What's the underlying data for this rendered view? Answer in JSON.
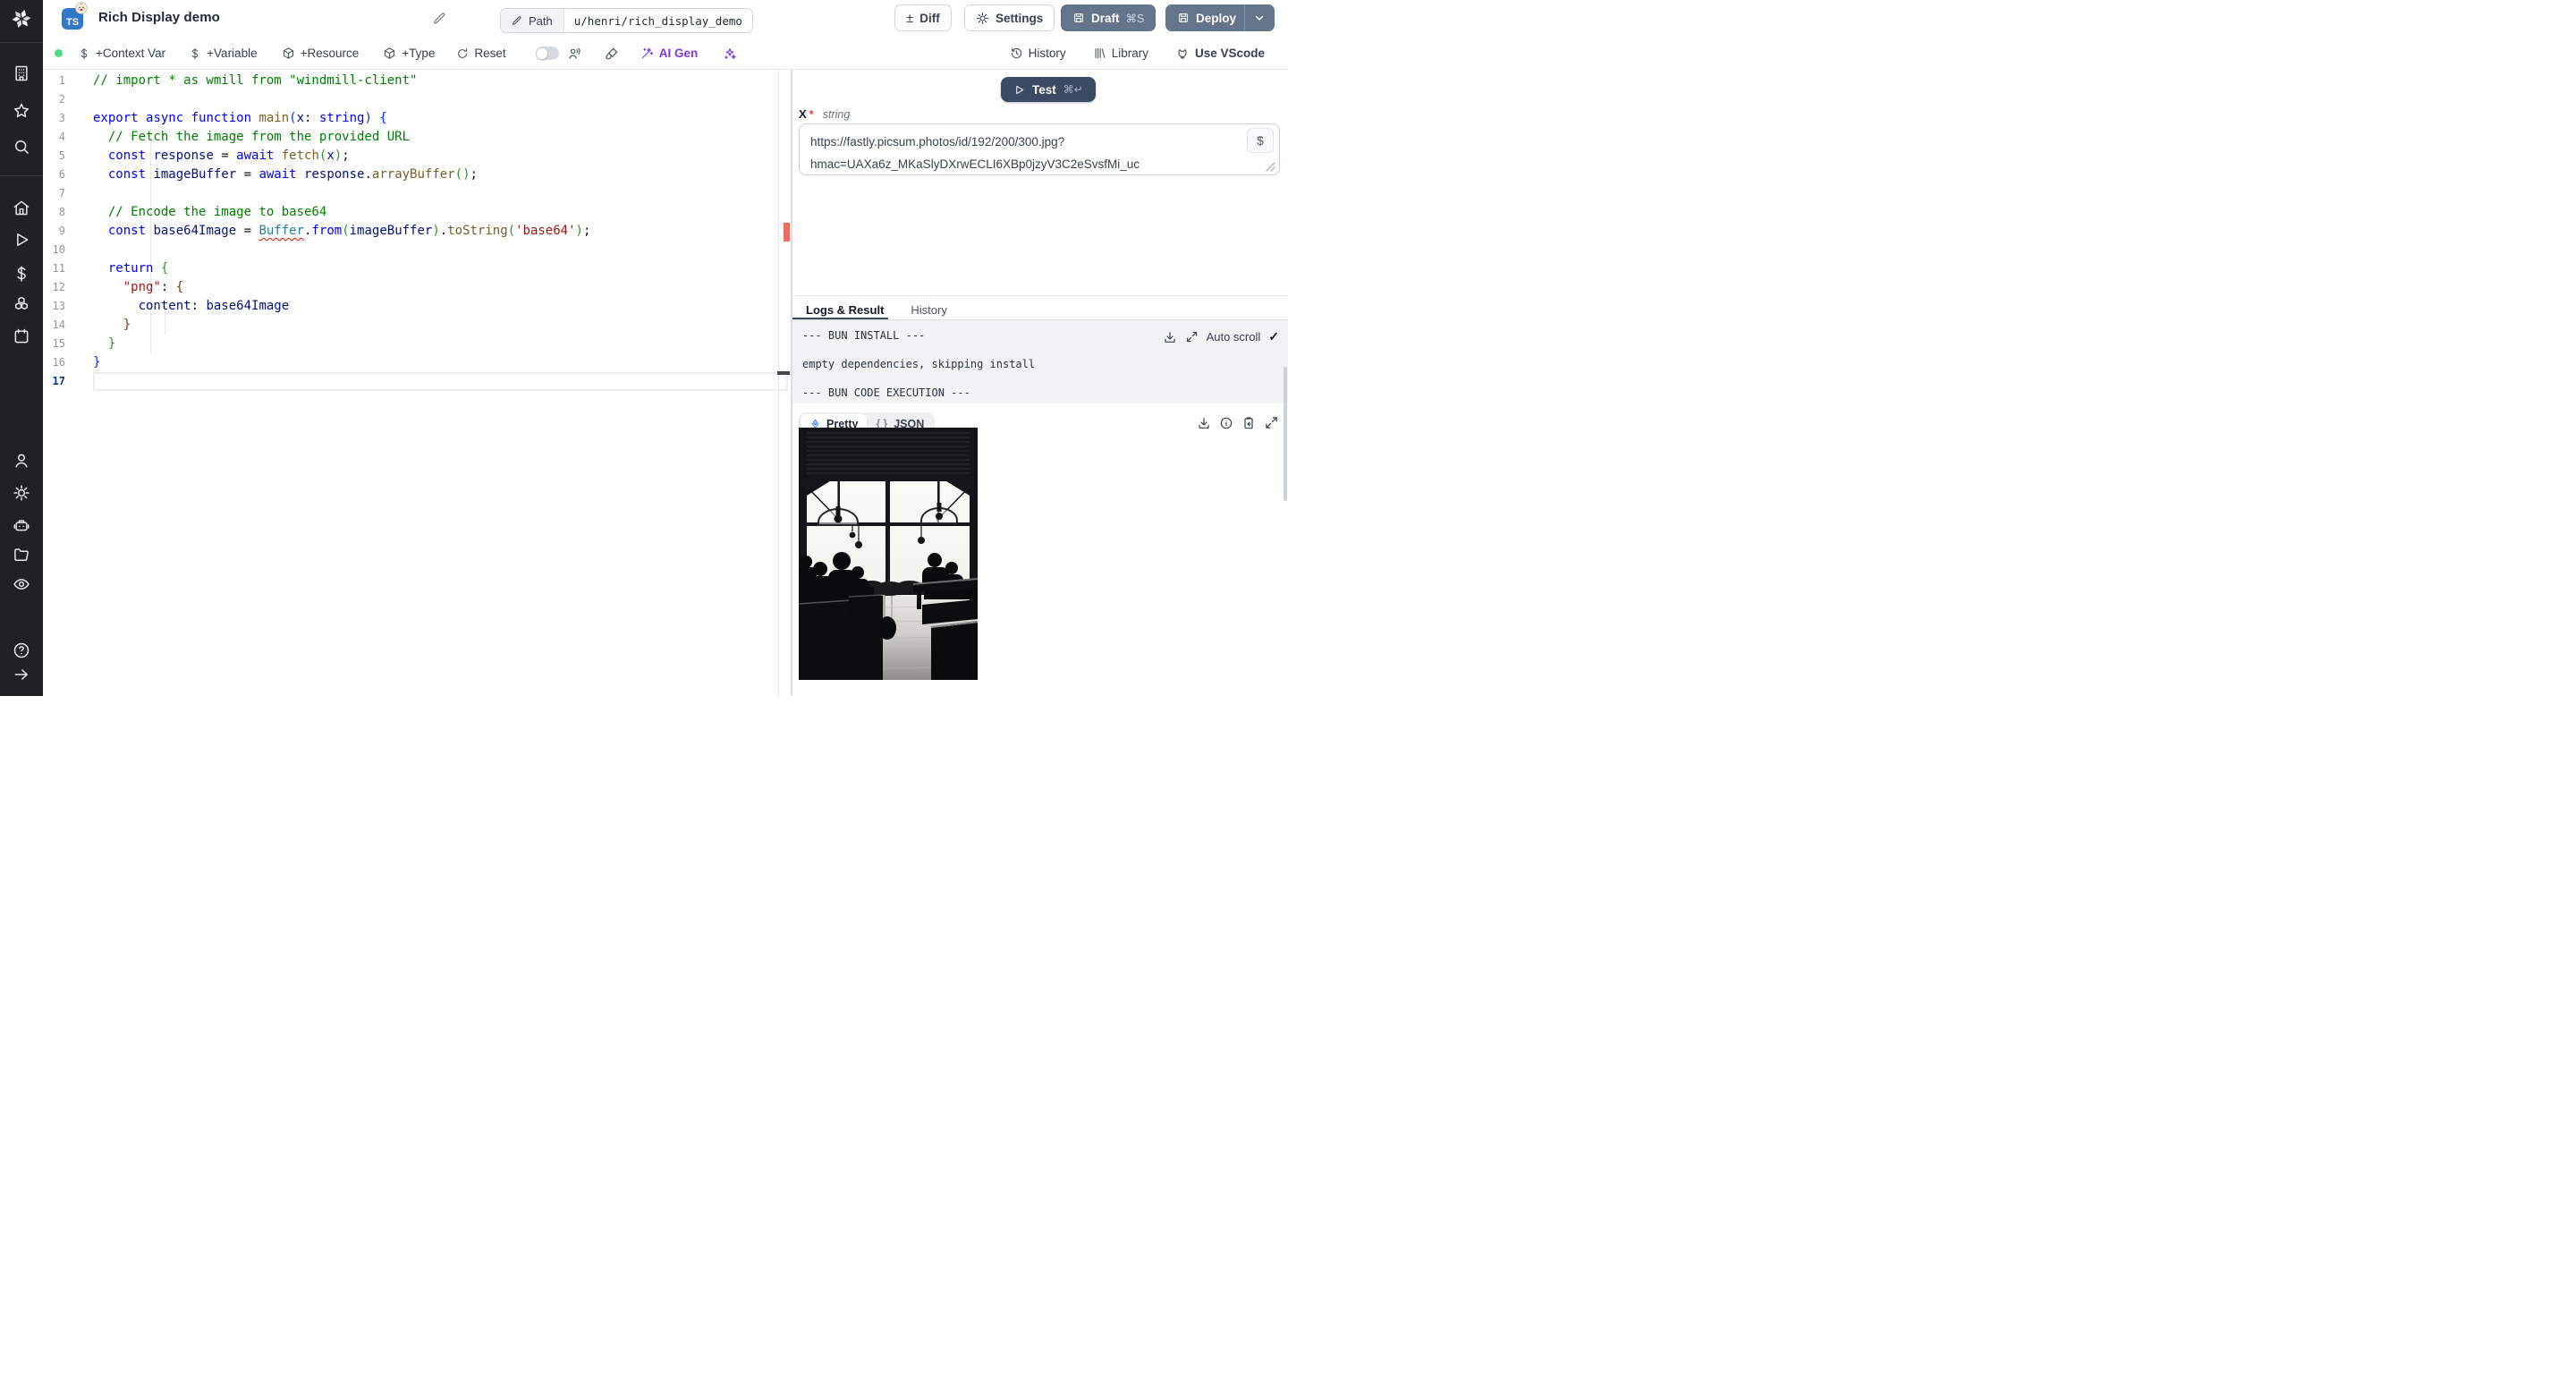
{
  "app": {
    "brand": "Windmill"
  },
  "colors": {
    "accent_purple": "#7c3aed",
    "button_slate": "#64748b",
    "test_button": "#3b4a63",
    "success_green": "#4ade80",
    "error_red": "#ed6c61",
    "ts_badge_blue": "#3178c6",
    "sidebar_bg": "#1f2127"
  },
  "sidebar": {
    "top_icons": [
      "building",
      "star",
      "search"
    ],
    "mid_icons": [
      "home",
      "play",
      "dollar",
      "cubes",
      "calendar"
    ],
    "lower_icons": [
      "user",
      "gear",
      "robot",
      "folder",
      "eye"
    ],
    "bottom_icons": [
      "help",
      "arrow-right"
    ]
  },
  "header": {
    "lang_badge": "TS",
    "title": "Rich Display demo",
    "path_chip": {
      "label": "Path",
      "value": "u/henri/rich_display_demo"
    },
    "actions": {
      "diff": "Diff",
      "settings": "Settings",
      "draft": "Draft",
      "draft_shortcut": "⌘S",
      "deploy": "Deploy"
    }
  },
  "toolbar": {
    "context_var": "+Context Var",
    "variable": "+Variable",
    "resource": "+Resource",
    "type": "+Type",
    "reset": "Reset",
    "ai_gen": "AI Gen",
    "history": "History",
    "library": "Library",
    "vscode": "Use VScode"
  },
  "editor": {
    "active_line": 17,
    "lines": [
      {
        "n": 1,
        "tokens": [
          [
            "// import * as wmill from \"windmill-client\"",
            "cm"
          ]
        ]
      },
      {
        "n": 2,
        "tokens": []
      },
      {
        "n": 3,
        "tokens": [
          [
            "export ",
            "kw"
          ],
          [
            "async ",
            "kw"
          ],
          [
            "function ",
            "kw"
          ],
          [
            "main",
            "fn"
          ],
          [
            "(",
            "b1"
          ],
          [
            "x",
            "vr"
          ],
          [
            ": ",
            "pl"
          ],
          [
            "string",
            "kw"
          ],
          [
            ")",
            "b1"
          ],
          [
            " ",
            "pl"
          ],
          [
            "{",
            "b1"
          ]
        ]
      },
      {
        "n": 4,
        "tokens": [
          [
            "  ",
            "pl"
          ],
          [
            "// Fetch the image from the provided URL",
            "cm"
          ]
        ]
      },
      {
        "n": 5,
        "tokens": [
          [
            "  ",
            "pl"
          ],
          [
            "const ",
            "kw"
          ],
          [
            "response",
            "vr"
          ],
          [
            " = ",
            "pl"
          ],
          [
            "await ",
            "kw"
          ],
          [
            "fetch",
            "fn"
          ],
          [
            "(",
            "b2"
          ],
          [
            "x",
            "vr"
          ],
          [
            ")",
            "b2"
          ],
          [
            ";",
            "pl"
          ]
        ]
      },
      {
        "n": 6,
        "tokens": [
          [
            "  ",
            "pl"
          ],
          [
            "const ",
            "kw"
          ],
          [
            "imageBuffer",
            "vr"
          ],
          [
            " = ",
            "pl"
          ],
          [
            "await ",
            "kw"
          ],
          [
            "response",
            "vr"
          ],
          [
            ".",
            "pl"
          ],
          [
            "arrayBuffer",
            "fn"
          ],
          [
            "(",
            "b2"
          ],
          [
            ")",
            "b2"
          ],
          [
            ";",
            "pl"
          ]
        ]
      },
      {
        "n": 7,
        "tokens": []
      },
      {
        "n": 8,
        "tokens": [
          [
            "  ",
            "pl"
          ],
          [
            "// Encode the image to base64",
            "cm"
          ]
        ]
      },
      {
        "n": 9,
        "tokens": [
          [
            "  ",
            "pl"
          ],
          [
            "const ",
            "kw"
          ],
          [
            "base64Image",
            "vr"
          ],
          [
            " = ",
            "pl"
          ],
          [
            "Buffer",
            "er"
          ],
          [
            ".",
            "pl"
          ],
          [
            "from",
            "kw"
          ],
          [
            "(",
            "b2"
          ],
          [
            "imageBuffer",
            "vr"
          ],
          [
            ")",
            "b2"
          ],
          [
            ".",
            "pl"
          ],
          [
            "toString",
            "fn"
          ],
          [
            "(",
            "b2"
          ],
          [
            "'base64'",
            "st"
          ],
          [
            ")",
            "b2"
          ],
          [
            ";",
            "pl"
          ]
        ]
      },
      {
        "n": 10,
        "tokens": []
      },
      {
        "n": 11,
        "tokens": [
          [
            "  ",
            "pl"
          ],
          [
            "return ",
            "kw"
          ],
          [
            "{",
            "b2"
          ]
        ]
      },
      {
        "n": 12,
        "tokens": [
          [
            "    ",
            "pl"
          ],
          [
            "\"png\"",
            "st"
          ],
          [
            ": ",
            "pl"
          ],
          [
            "{",
            "b3"
          ]
        ]
      },
      {
        "n": 13,
        "tokens": [
          [
            "      ",
            "pl"
          ],
          [
            "content",
            "vr"
          ],
          [
            ": ",
            "pl"
          ],
          [
            "base64Image",
            "vr"
          ]
        ]
      },
      {
        "n": 14,
        "tokens": [
          [
            "    ",
            "pl"
          ],
          [
            "}",
            "b3"
          ]
        ]
      },
      {
        "n": 15,
        "tokens": [
          [
            "  ",
            "pl"
          ],
          [
            "}",
            "b2"
          ]
        ]
      },
      {
        "n": 16,
        "tokens": [
          [
            "}",
            "b1"
          ]
        ]
      },
      {
        "n": 17,
        "tokens": []
      }
    ]
  },
  "run_panel": {
    "test_button": {
      "label": "Test",
      "shortcut": "⌘↵"
    },
    "argument": {
      "name": "x",
      "required_mark": "*",
      "type": "string",
      "value": "https://fastly.picsum.photos/id/192/200/300.jpg?hmac=UAXa6z_MKaSlyDXrwECLI6XBp0jzyV3C2eSvsfMi_uc",
      "insert_var_label": "$"
    },
    "tabs": {
      "logs_result": "Logs & Result",
      "history": "History"
    },
    "logs": {
      "lines": [
        "--- BUN INSTALL ---",
        "empty dependencies, skipping install",
        "--- BUN CODE EXECUTION ---"
      ],
      "auto_scroll_label": "Auto scroll",
      "auto_scroll_checked": "✓"
    },
    "result": {
      "pretty_label": "Pretty",
      "json_label": "JSON",
      "image_description": "black-and-white photo: silhouetted people at tables in front of large bright cafe windows with pendant lamps"
    }
  }
}
